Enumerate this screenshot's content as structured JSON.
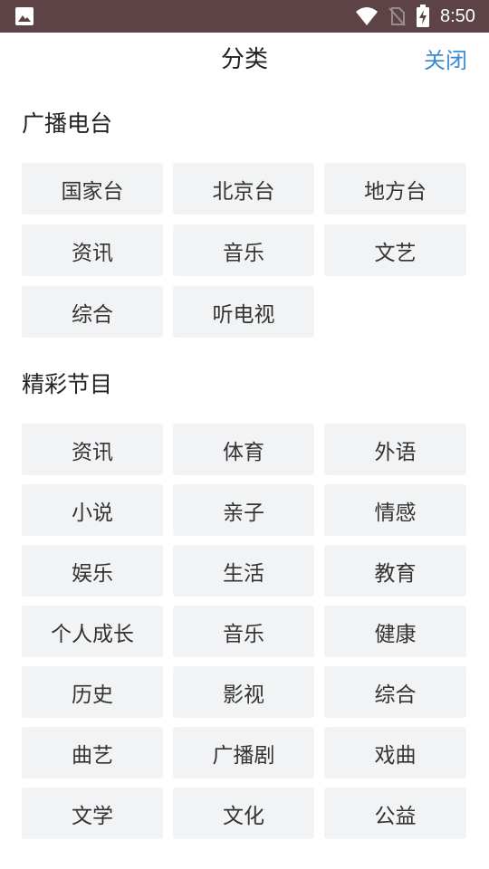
{
  "status_bar": {
    "time": "8:50"
  },
  "header": {
    "title": "分类",
    "close_label": "关闭"
  },
  "sections": [
    {
      "title": "广播电台",
      "items": [
        "国家台",
        "北京台",
        "地方台",
        "资讯",
        "音乐",
        "文艺",
        "综合",
        "听电视"
      ]
    },
    {
      "title": "精彩节目",
      "items": [
        "资讯",
        "体育",
        "外语",
        "小说",
        "亲子",
        "情感",
        "娱乐",
        "生活",
        "教育",
        "个人成长",
        "音乐",
        "健康",
        "历史",
        "影视",
        "综合",
        "曲艺",
        "广播剧",
        "戏曲",
        "文学",
        "文化",
        "公益"
      ]
    }
  ]
}
